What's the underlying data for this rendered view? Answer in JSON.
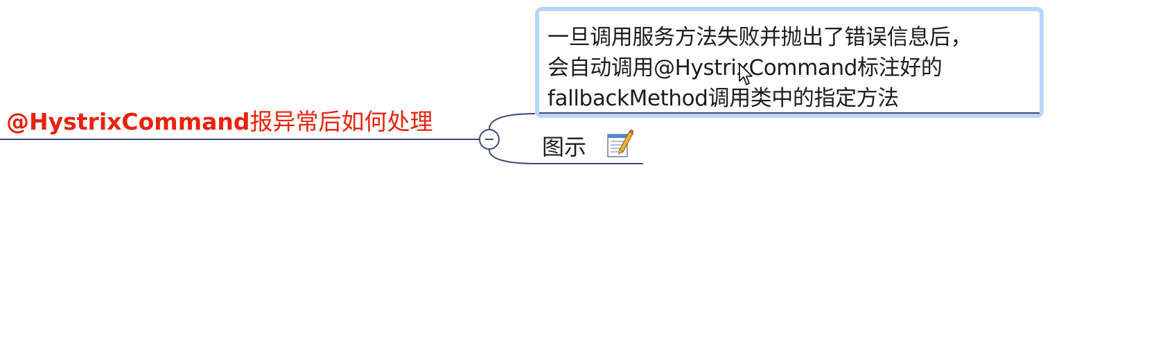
{
  "mindmap": {
    "parent_topic": {
      "label_bold": "@HystrixCommand",
      "label_rest": "报异常后如何处理"
    },
    "selected_topic": {
      "label": "一旦调用服务方法失败并抛出了错误信息后，\n会自动调用@HystrixCommand标注好的\nfallbackMethod调用类中的指定方法"
    },
    "child_topic": {
      "label": "图示"
    },
    "icons": {
      "collapse": "minus-circle-icon",
      "note": "note-pencil-icon",
      "cursor": "mouse-pointer-icon"
    }
  },
  "colors": {
    "parent_text": "#e8220c",
    "connector": "#3a4a7a",
    "selection_border": "#b5d6f6"
  }
}
